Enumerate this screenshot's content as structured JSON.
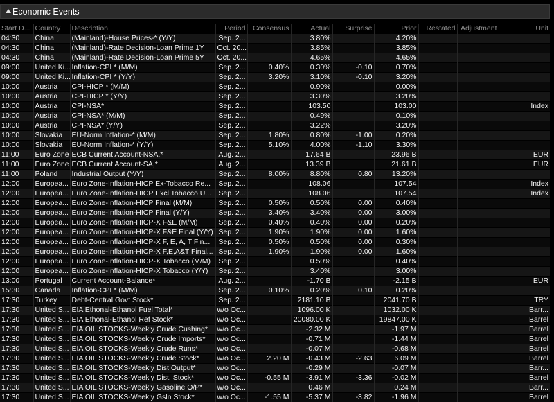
{
  "panel": {
    "title": "Economic Events"
  },
  "columns": [
    "Start D...",
    "Country",
    "Description",
    "Period",
    "Consensus",
    "Actual",
    "Surprise",
    "Prior",
    "Restated",
    "Adjustment",
    "Unit"
  ],
  "rows": [
    [
      "04:30",
      "China",
      "(Mainland)-House Prices-* (Y/Y)",
      "Sep. 2...",
      "",
      "3.80%",
      "",
      "4.20%",
      "",
      "",
      ""
    ],
    [
      "04:30",
      "China",
      "(Mainland)-Rate Decision-Loan Prime 1Y",
      "Oct. 20...",
      "",
      "3.85%",
      "",
      "3.85%",
      "",
      "",
      ""
    ],
    [
      "04:30",
      "China",
      "(Mainland)-Rate Decision-Loan Prime 5Y",
      "Oct. 20...",
      "",
      "4.65%",
      "",
      "4.65%",
      "",
      "",
      ""
    ],
    [
      "09:00",
      "United Ki...",
      "Inflation-CPI * (M/M)",
      "Sep. 2...",
      "0.40%",
      "0.30%",
      "-0.10",
      "0.70%",
      "",
      "",
      ""
    ],
    [
      "09:00",
      "United Ki...",
      "Inflation-CPI * (Y/Y)",
      "Sep. 2...",
      "3.20%",
      "3.10%",
      "-0.10",
      "3.20%",
      "",
      "",
      ""
    ],
    [
      "10:00",
      "Austria",
      "CPI-HICP * (M/M)",
      "Sep. 2...",
      "",
      "0.90%",
      "",
      "0.00%",
      "",
      "",
      ""
    ],
    [
      "10:00",
      "Austria",
      "CPI-HICP * (Y/Y)",
      "Sep. 2...",
      "",
      "3.30%",
      "",
      "3.20%",
      "",
      "",
      ""
    ],
    [
      "10:00",
      "Austria",
      "CPI-NSA*",
      "Sep. 2...",
      "",
      "103.50",
      "",
      "103.00",
      "",
      "",
      "Index"
    ],
    [
      "10:00",
      "Austria",
      "CPI-NSA* (M/M)",
      "Sep. 2...",
      "",
      "0.49%",
      "",
      "0.10%",
      "",
      "",
      ""
    ],
    [
      "10:00",
      "Austria",
      "CPI-NSA* (Y/Y)",
      "Sep. 2...",
      "",
      "3.22%",
      "",
      "3.20%",
      "",
      "",
      ""
    ],
    [
      "10:00",
      "Slovakia",
      "EU-Norm Inflation-* (M/M)",
      "Sep. 2...",
      "1.80%",
      "0.80%",
      "-1.00",
      "0.20%",
      "",
      "",
      ""
    ],
    [
      "10:00",
      "Slovakia",
      "EU-Norm Inflation-* (Y/Y)",
      "Sep. 2...",
      "5.10%",
      "4.00%",
      "-1.10",
      "3.30%",
      "",
      "",
      ""
    ],
    [
      "11:00",
      "Euro Zone",
      "ECB Current Account-NSA,*",
      "Aug. 2...",
      "",
      "17.64 B",
      "",
      "23.96 B",
      "",
      "",
      "EUR"
    ],
    [
      "11:00",
      "Euro Zone",
      "ECB Current Account-SA,*",
      "Aug. 2...",
      "",
      "13.39 B",
      "",
      "21.61 B",
      "",
      "",
      "EUR"
    ],
    [
      "11:00",
      "Poland",
      "Industrial Output (Y/Y)",
      "Sep. 2...",
      "8.00%",
      "8.80%",
      "0.80",
      "13.20%",
      "",
      "",
      ""
    ],
    [
      "12:00",
      "Europea...",
      "Euro Zone-Inflation-HICP Ex-Tobacco Re...",
      "Sep. 2...",
      "",
      "108.06",
      "",
      "107.54",
      "",
      "",
      "Index"
    ],
    [
      "12:00",
      "Europea...",
      "Euro Zone-Inflation-HICP Excl Tobacco U...",
      "Sep. 2...",
      "",
      "108.06",
      "",
      "107.54",
      "",
      "",
      "Index"
    ],
    [
      "12:00",
      "Europea...",
      "Euro Zone-Inflation-HICP Final (M/M)",
      "Sep. 2...",
      "0.50%",
      "0.50%",
      "0.00",
      "0.40%",
      "",
      "",
      ""
    ],
    [
      "12:00",
      "Europea...",
      "Euro Zone-Inflation-HICP Final (Y/Y)",
      "Sep. 2...",
      "3.40%",
      "3.40%",
      "0.00",
      "3.00%",
      "",
      "",
      ""
    ],
    [
      "12:00",
      "Europea...",
      "Euro Zone-Inflation-HICP-X F&E (M/M)",
      "Sep. 2...",
      "0.40%",
      "0.40%",
      "0.00",
      "0.20%",
      "",
      "",
      ""
    ],
    [
      "12:00",
      "Europea...",
      "Euro Zone-Inflation-HICP-X F&E Final (Y/Y)",
      "Sep. 2...",
      "1.90%",
      "1.90%",
      "0.00",
      "1.60%",
      "",
      "",
      ""
    ],
    [
      "12:00",
      "Europea...",
      "Euro Zone-Inflation-HICP-X F, E, A, T Fin...",
      "Sep. 2...",
      "0.50%",
      "0.50%",
      "0.00",
      "0.30%",
      "",
      "",
      ""
    ],
    [
      "12:00",
      "Europea...",
      "Euro Zone-Inflation-HICP-X F,E,A&T Final...",
      "Sep. 2...",
      "1.90%",
      "1.90%",
      "0.00",
      "1.60%",
      "",
      "",
      ""
    ],
    [
      "12:00",
      "Europea...",
      "Euro Zone-Inflation-HICP-X Tobacco (M/M)",
      "Sep. 2...",
      "",
      "0.50%",
      "",
      "0.40%",
      "",
      "",
      ""
    ],
    [
      "12:00",
      "Europea...",
      "Euro Zone-Inflation-HICP-X Tobacco (Y/Y)",
      "Sep. 2...",
      "",
      "3.40%",
      "",
      "3.00%",
      "",
      "",
      ""
    ],
    [
      "13:00",
      "Portugal",
      "Current Account-Balance*",
      "Aug. 2...",
      "",
      "-1.70 B",
      "",
      "-2.15 B",
      "",
      "",
      "EUR"
    ],
    [
      "15:30",
      "Canada",
      "Inflation-CPI * (M/M)",
      "Sep. 2...",
      "0.10%",
      "0.20%",
      "0.10",
      "0.20%",
      "",
      "",
      ""
    ],
    [
      "17:30",
      "Turkey",
      "Debt-Central Govt Stock*",
      "Sep. 2...",
      "",
      "2181.10 B",
      "",
      "2041.70 B",
      "",
      "",
      "TRY"
    ],
    [
      "17:30",
      "United S...",
      "EIA Ethonal-Ethanol Fuel Total*",
      "w/o Oc...",
      "",
      "1096.00 K",
      "",
      "1032.00 K",
      "",
      "",
      "Barr..."
    ],
    [
      "17:30",
      "United S...",
      "EIA Ethonal-Ethanol Ref Stock*",
      "w/o Oc...",
      "",
      "20080.00 K",
      "",
      "19847.00 K",
      "",
      "",
      "Barrel"
    ],
    [
      "17:30",
      "United S...",
      "EIA OIL STOCKS-Weekly Crude Cushing*",
      "w/o Oc...",
      "",
      "-2.32 M",
      "",
      "-1.97 M",
      "",
      "",
      "Barrel"
    ],
    [
      "17:30",
      "United S...",
      "EIA OIL STOCKS-Weekly Crude Imports*",
      "w/o Oc...",
      "",
      "-0.71 M",
      "",
      "-1.44 M",
      "",
      "",
      "Barrel"
    ],
    [
      "17:30",
      "United S...",
      "EIA OIL STOCKS-Weekly Crude Runs*",
      "w/o Oc...",
      "",
      "-0.07 M",
      "",
      "-0.68 M",
      "",
      "",
      "Barrel"
    ],
    [
      "17:30",
      "United S...",
      "EIA OIL STOCKS-Weekly Crude Stock*",
      "w/o Oc...",
      "2.20 M",
      "-0.43 M",
      "-2.63",
      "6.09 M",
      "",
      "",
      "Barrel"
    ],
    [
      "17:30",
      "United S...",
      "EIA OIL STOCKS-Weekly Dist Output*",
      "w/o Oc...",
      "",
      "-0.29 M",
      "",
      "-0.07 M",
      "",
      "",
      "Barr..."
    ],
    [
      "17:30",
      "United S...",
      "EIA OIL STOCKS-Weekly Dist. Stock*",
      "w/o Oc...",
      "-0.55 M",
      "-3.91 M",
      "-3.36",
      "-0.02 M",
      "",
      "",
      "Barrel"
    ],
    [
      "17:30",
      "United S...",
      "EIA OIL STOCKS-Weekly Gasoline O/P*",
      "w/o Oc...",
      "",
      "0.46 M",
      "",
      "0.24 M",
      "",
      "",
      "Barr..."
    ],
    [
      "17:30",
      "United S...",
      "EIA OIL STOCKS-Weekly Gsln Stock*",
      "w/o Oc...",
      "-1.55 M",
      "-5.37 M",
      "-3.82",
      "-1.96 M",
      "",
      "",
      "Barrel"
    ]
  ]
}
